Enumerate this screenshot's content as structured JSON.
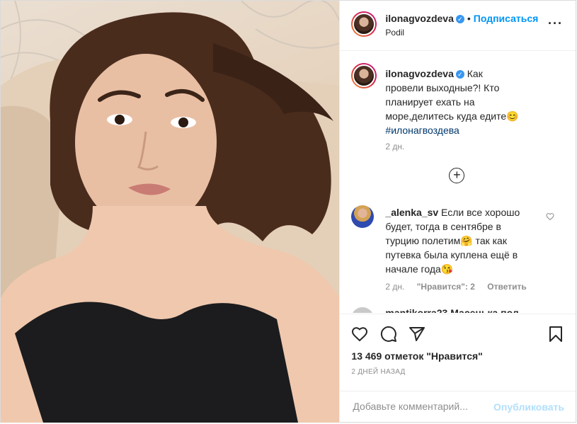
{
  "post": {
    "username": "ilonagvozdeva",
    "follow_label": "Подписаться",
    "separator": "•",
    "location": "Podil",
    "more_label": "···"
  },
  "caption": {
    "username": "ilonagvozdeva",
    "text": "Как провели выходные?! Кто планирует ехать на море,делитесь куда едите😊",
    "hashtag": "#илонагвоздева",
    "time": "2 дн."
  },
  "load_more_label": "+",
  "comment": {
    "username": "_alenka_sv",
    "text": "Если все хорошо будет, тогда в сентябре в турцию полетим🤗 так как путевка была куплена ещё в начале года😘",
    "time": "2 дн.",
    "likes_label": "\"Нравится\": 2",
    "reply_label": "Ответить"
  },
  "next_comment": {
    "preview": "mantikorra23 Масенька пол"
  },
  "actions": {
    "likes_text": "13 469 отметок \"Нравится\"",
    "time_ago": "2 ДНЕЙ НАЗАД"
  },
  "add_comment": {
    "placeholder": "Добавьте комментарий...",
    "publish_label": "Опубликовать"
  },
  "colors": {
    "accent": "#0095f6",
    "link": "#00376b",
    "muted": "#8e8e8e",
    "publish_disabled": "#b2dffc"
  }
}
